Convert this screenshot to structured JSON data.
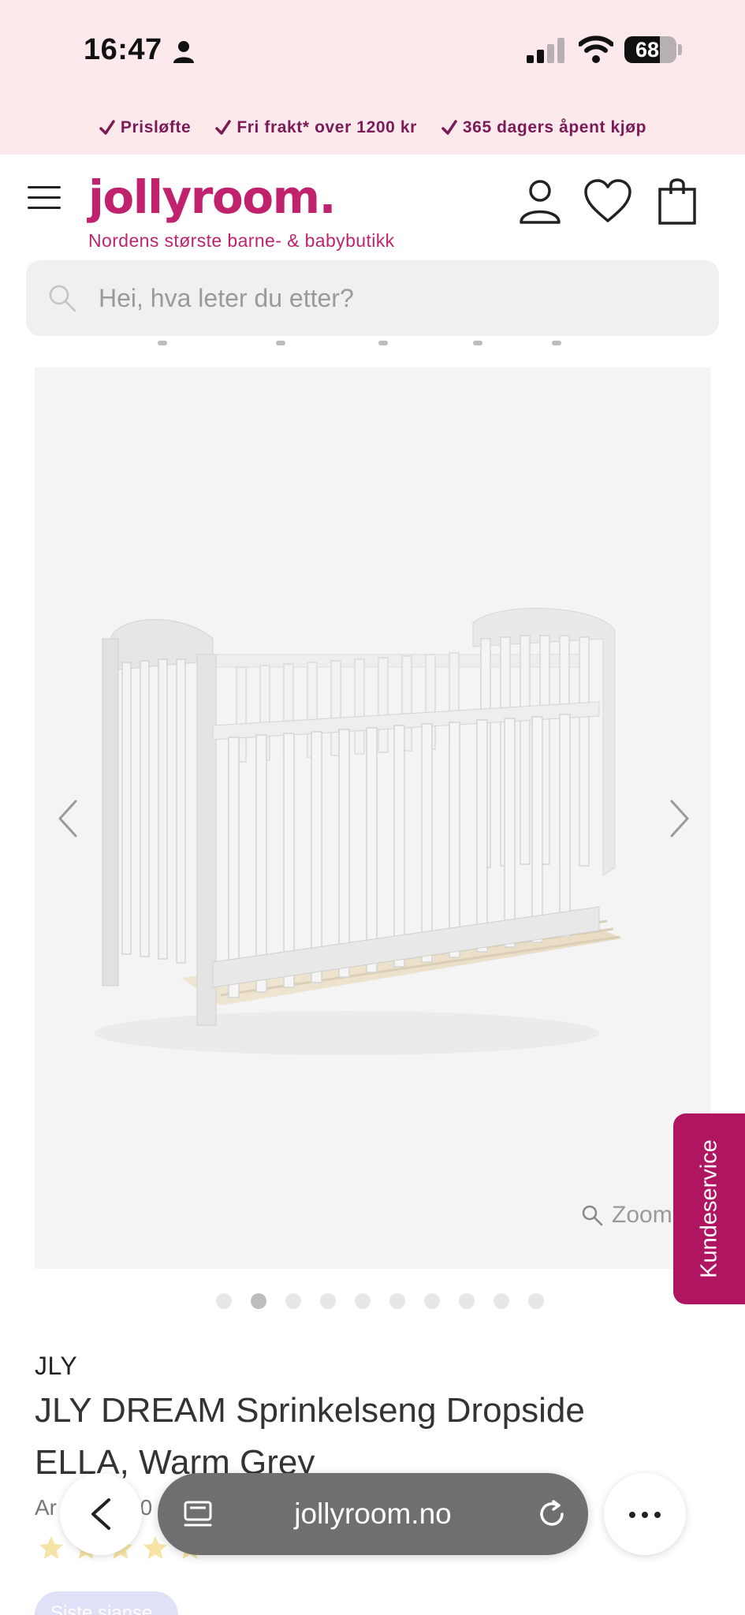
{
  "status_bar": {
    "time": "16:47",
    "battery": "68",
    "battery_level": 0.68
  },
  "promo": [
    {
      "label": "Prisløfte"
    },
    {
      "label": "Fri frakt* over 1200 kr"
    },
    {
      "label": "365 dagers åpent kjøp"
    }
  ],
  "header": {
    "logo": "jollyroom.",
    "tagline": "Nordens største barne- & babybutikk"
  },
  "search": {
    "placeholder": "Hei, hva leter du etter?"
  },
  "gallery": {
    "zoom_label": "Zoom",
    "image_count": 10,
    "active_index": 1
  },
  "kundeservice": {
    "label": "Kundeservice"
  },
  "product": {
    "brand": "JLY",
    "title": "JLY DREAM Sprinkelseng Dropside ELLA, Warm Grey",
    "article_number": "Ar",
    "article_suffix": "40",
    "rating_stars": 5,
    "chip_label": "Siste sjanse"
  },
  "browser": {
    "url": "jollyroom.no"
  },
  "colors": {
    "brand": "#c0226e",
    "promo_text": "#7a1b57",
    "kundeservice_bg": "#b01561",
    "top_bg": "#fbe9ec"
  },
  "icons": {
    "menu": "hamburger-icon",
    "account": "person-icon",
    "wishlist": "heart-icon",
    "cart": "shopping-bag-icon",
    "search": "search-icon",
    "prev": "chevron-left-icon",
    "next": "chevron-right-icon",
    "zoom": "magnifier-icon",
    "back": "chevron-left-icon",
    "tabs": "tabs-icon",
    "reload": "reload-icon",
    "more": "more-icon"
  }
}
